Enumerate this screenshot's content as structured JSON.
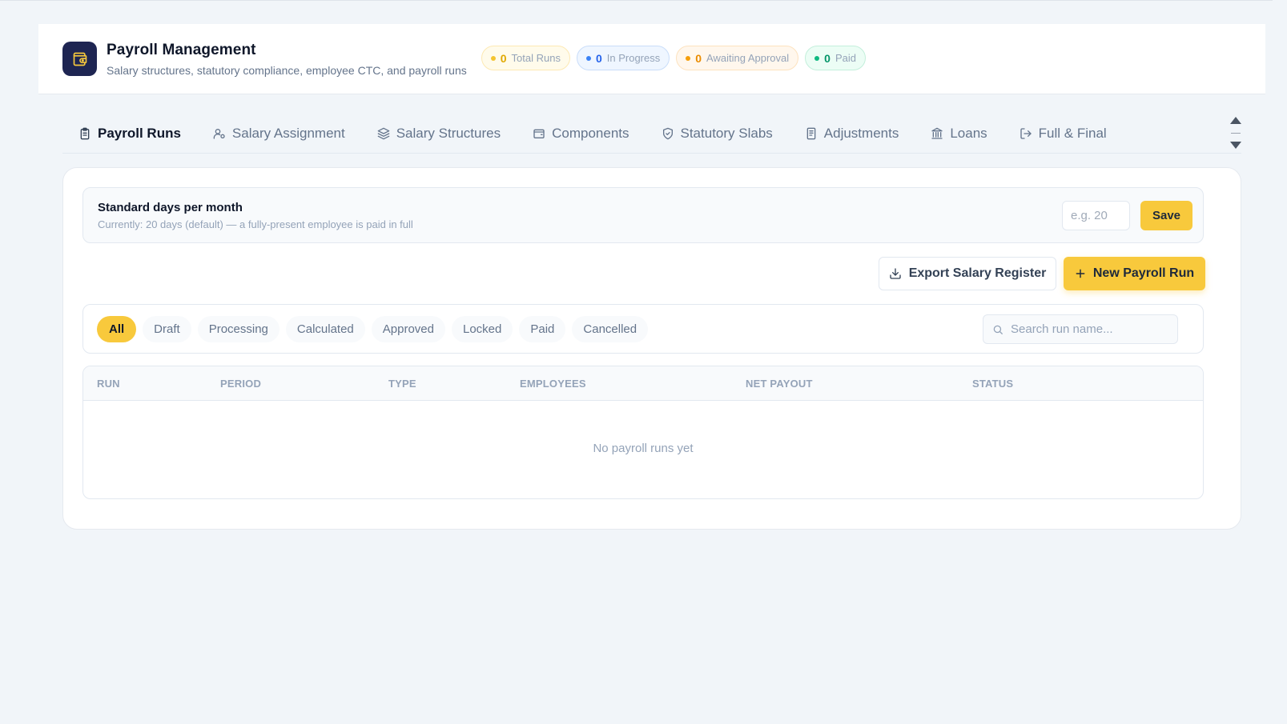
{
  "header": {
    "title": "Payroll Management",
    "subtitle": "Salary structures, statutory compliance, employee CTC, and payroll runs",
    "stats": {
      "total": {
        "count": "0",
        "label": "Total Runs"
      },
      "in_progress": {
        "count": "0",
        "label": "In Progress"
      },
      "awaiting": {
        "count": "0",
        "label": "Awaiting Approval"
      },
      "paid": {
        "count": "0",
        "label": "Paid"
      }
    }
  },
  "tabs": [
    {
      "label": "Payroll Runs",
      "icon": "clipboard-icon",
      "active": true
    },
    {
      "label": "Salary Assignment",
      "icon": "user-settings-icon"
    },
    {
      "label": "Salary Structures",
      "icon": "layers-icon"
    },
    {
      "label": "Components",
      "icon": "wallet-icon"
    },
    {
      "label": "Statutory Slabs",
      "icon": "shield-icon"
    },
    {
      "label": "Adjustments",
      "icon": "receipt-icon"
    },
    {
      "label": "Loans",
      "icon": "bank-icon"
    },
    {
      "label": "Full & Final",
      "icon": "exit-icon"
    }
  ],
  "standard_days": {
    "title": "Standard days per month",
    "subtitle": "Currently: 20 days (default) — a fully-present employee is paid in full",
    "input_placeholder": "e.g. 20",
    "input_value": "",
    "save_label": "Save"
  },
  "actions": {
    "export_label": "Export Salary Register",
    "new_run_label": "New Payroll Run"
  },
  "filters": {
    "chips": [
      "All",
      "Draft",
      "Processing",
      "Calculated",
      "Approved",
      "Locked",
      "Paid",
      "Cancelled"
    ],
    "active": "All",
    "search_placeholder": "Search run name..."
  },
  "table": {
    "columns": [
      "RUN",
      "PERIOD",
      "TYPE",
      "EMPLOYEES",
      "NET PAYOUT",
      "STATUS"
    ],
    "rows": [],
    "empty_text": "No payroll runs yet"
  },
  "colors": {
    "accent": "#f8c93c",
    "brand_icon_bg": "#1e2552",
    "page_bg": "#f1f5f9"
  }
}
